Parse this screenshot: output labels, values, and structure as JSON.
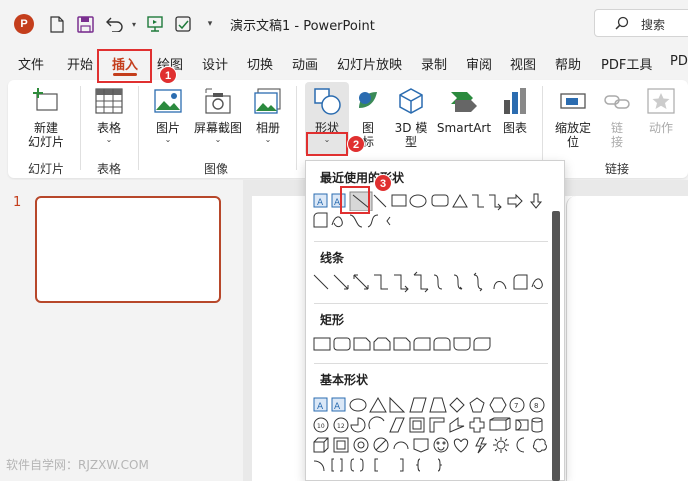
{
  "window": {
    "title": "演示文稿1  -  PowerPoint",
    "app_logo": "P"
  },
  "search": {
    "label": "搜索"
  },
  "tabs": [
    {
      "label": "文件"
    },
    {
      "label": "开始"
    },
    {
      "label": "插入",
      "active": true
    },
    {
      "label": "绘图"
    },
    {
      "label": "设计"
    },
    {
      "label": "切换"
    },
    {
      "label": "动画"
    },
    {
      "label": "幻灯片放映"
    },
    {
      "label": "录制"
    },
    {
      "label": "审阅"
    },
    {
      "label": "视图"
    },
    {
      "label": "帮助"
    },
    {
      "label": "PDF工具"
    },
    {
      "label": "PD"
    }
  ],
  "ribbon": {
    "new_slide": "新建\n幻灯片",
    "table": "表格",
    "picture": "图片",
    "screenshot": "屏幕截图",
    "album": "相册",
    "shapes": "形状",
    "icons": "图\n标",
    "model3d": "3D 模\n型",
    "smartart": "SmartArt",
    "chart": "图表",
    "zoom": "缩放定\n位",
    "link": "链\n接",
    "action": "动作",
    "groups": {
      "slides": "幻灯片",
      "tables": "表格",
      "images": "图像",
      "links": "链接"
    }
  },
  "badges": [
    "1",
    "2",
    "3"
  ],
  "thumbnail": {
    "number": "1"
  },
  "dropdown": {
    "recent": "最近使用的形状",
    "lines": "线条",
    "rectangles": "矩形",
    "basic": "基本形状"
  },
  "watermark": "软件自学网：RJZXW.COM",
  "colors": {
    "accent": "#c43e1c",
    "annotation": "#e03030"
  }
}
